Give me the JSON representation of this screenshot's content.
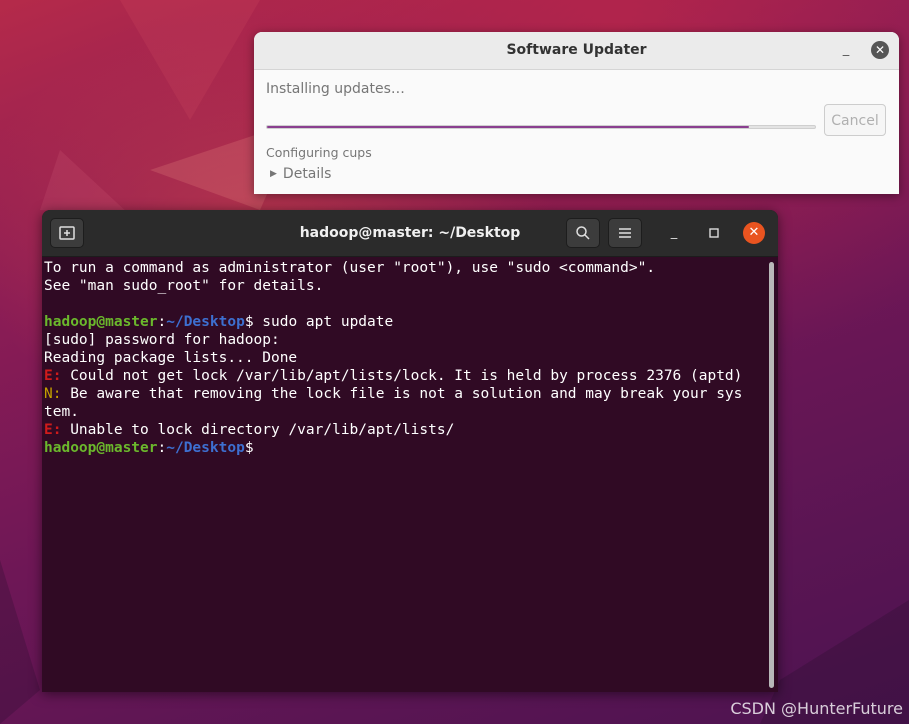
{
  "updater": {
    "title": "Software Updater",
    "status": "Installing updates…",
    "progress_fraction": 0.88,
    "cancel_label": "Cancel",
    "substatus": "Configuring cups",
    "details_label": "Details",
    "minimize_glyph": "_",
    "close_glyph": "✕"
  },
  "terminal": {
    "title": "hadoop@master: ~/Desktop",
    "lines": [
      [
        {
          "t": "To run a command as administrator (user \"root\"), use \"sudo <command>\".",
          "c": ""
        }
      ],
      [
        {
          "t": "See \"man sudo_root\" for details.",
          "c": ""
        }
      ],
      [
        {
          "t": "",
          "c": ""
        }
      ],
      [
        {
          "t": "hadoop@master",
          "c": "u"
        },
        {
          "t": ":",
          "c": ""
        },
        {
          "t": "~/Desktop",
          "c": "p"
        },
        {
          "t": "$ sudo apt update",
          "c": ""
        }
      ],
      [
        {
          "t": "[sudo] password for hadoop:",
          "c": ""
        }
      ],
      [
        {
          "t": "Reading package lists... Done",
          "c": ""
        }
      ],
      [
        {
          "t": "E:",
          "c": "e"
        },
        {
          "t": " Could not get lock /var/lib/apt/lists/lock. It is held by process 2376 (aptd)",
          "c": ""
        }
      ],
      [
        {
          "t": "N:",
          "c": "n"
        },
        {
          "t": " Be aware that removing the lock file is not a solution and may break your sys",
          "c": ""
        }
      ],
      [
        {
          "t": "tem.",
          "c": ""
        }
      ],
      [
        {
          "t": "E:",
          "c": "e"
        },
        {
          "t": " Unable to lock directory /var/lib/apt/lists/",
          "c": ""
        }
      ],
      [
        {
          "t": "hadoop@master",
          "c": "u"
        },
        {
          "t": ":",
          "c": ""
        },
        {
          "t": "~/Desktop",
          "c": "p"
        },
        {
          "t": "$",
          "c": ""
        }
      ]
    ],
    "colors": {
      "user": "#6bb82c",
      "path": "#3d6fd0",
      "error": "#d01b1b",
      "notice": "#c4a000",
      "background": "#300a24"
    }
  },
  "watermark": "CSDN @HunterFuture"
}
